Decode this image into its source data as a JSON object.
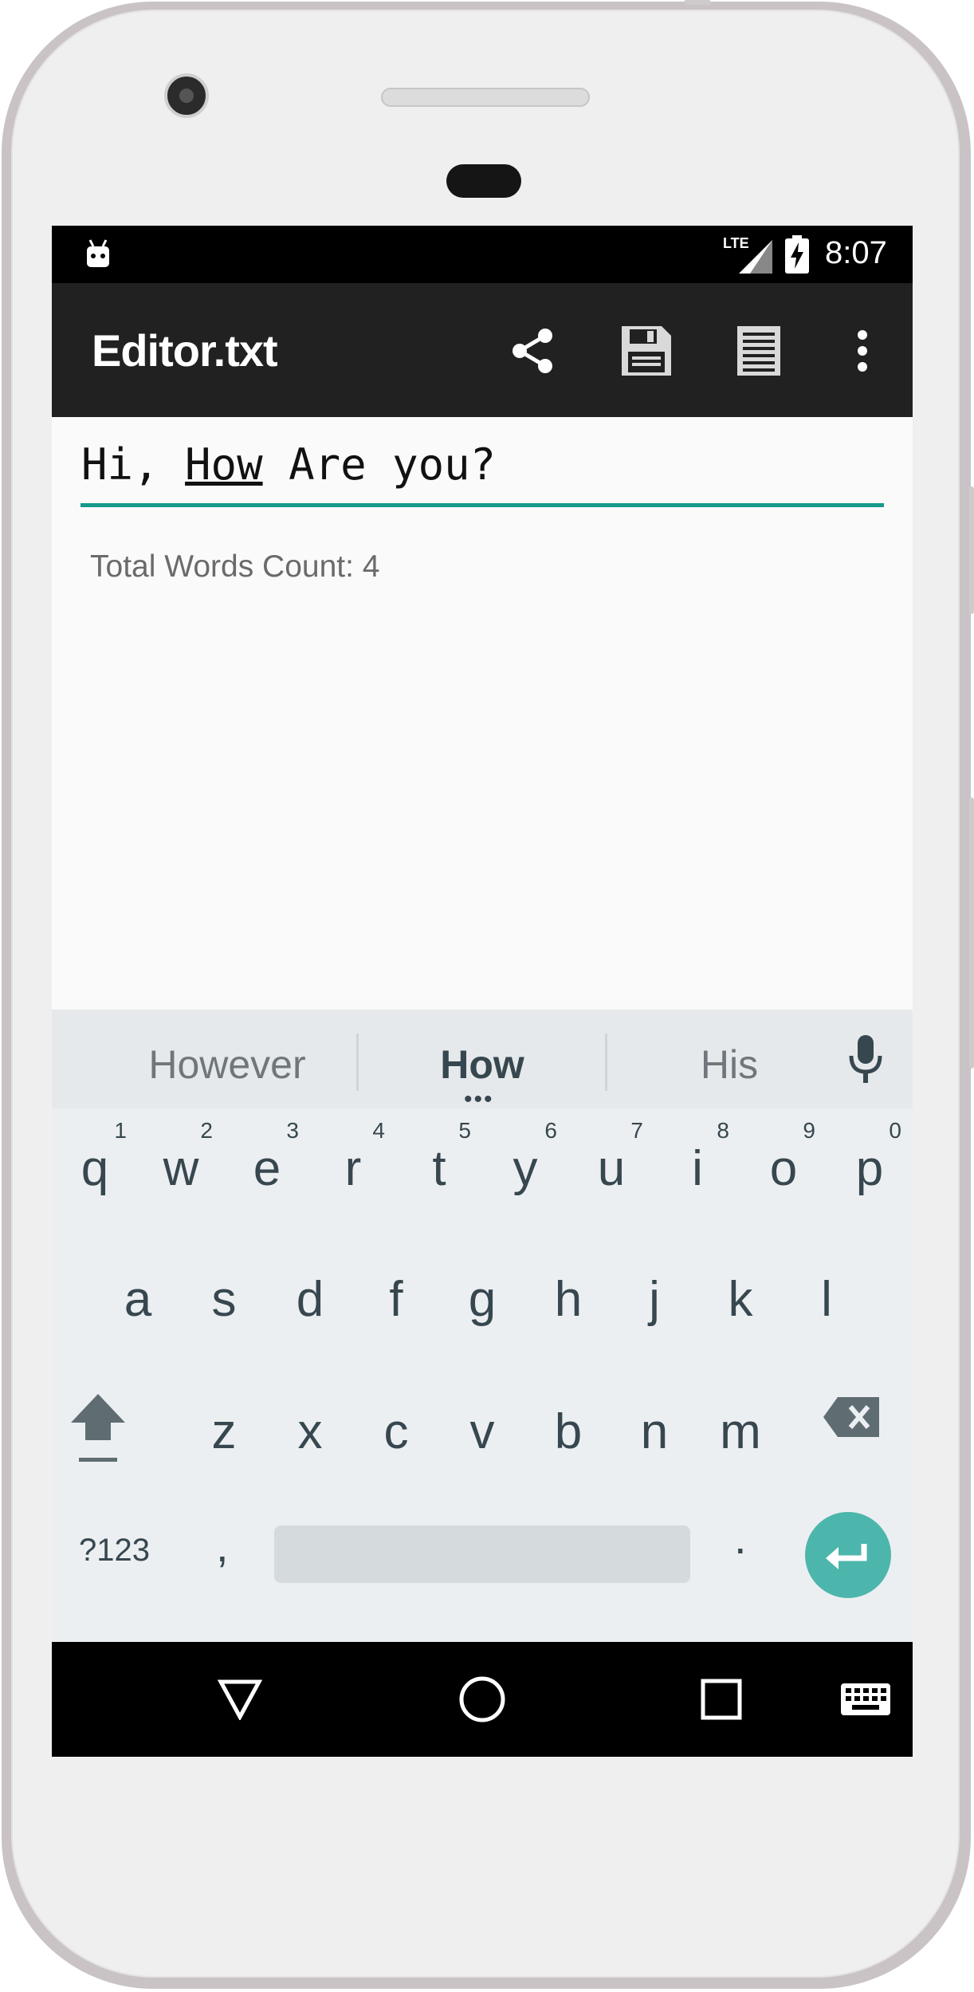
{
  "status_bar": {
    "network": "LTE",
    "time": "8:07"
  },
  "app_bar": {
    "title": "Editor.txt",
    "actions": [
      "share-icon",
      "save-icon",
      "document-icon",
      "more-vert-icon"
    ]
  },
  "editor": {
    "text_before": "Hi, ",
    "text_underlined": "How",
    "text_after": " Are you?",
    "word_count_label": "Total Words Count: 4",
    "accent_color": "#159a8c"
  },
  "keyboard": {
    "suggestions": [
      "However",
      "How",
      "His"
    ],
    "row1": [
      {
        "key": "q",
        "hint": "1"
      },
      {
        "key": "w",
        "hint": "2"
      },
      {
        "key": "e",
        "hint": "3"
      },
      {
        "key": "r",
        "hint": "4"
      },
      {
        "key": "t",
        "hint": "5"
      },
      {
        "key": "y",
        "hint": "6"
      },
      {
        "key": "u",
        "hint": "7"
      },
      {
        "key": "i",
        "hint": "8"
      },
      {
        "key": "o",
        "hint": "9"
      },
      {
        "key": "p",
        "hint": "0"
      }
    ],
    "row2": [
      "a",
      "s",
      "d",
      "f",
      "g",
      "h",
      "j",
      "k",
      "l"
    ],
    "row3": [
      "z",
      "x",
      "c",
      "v",
      "b",
      "n",
      "m"
    ],
    "symbols_label": "?123",
    "comma_label": ",",
    "period_label": ".",
    "enter_color": "#4db6ac"
  }
}
